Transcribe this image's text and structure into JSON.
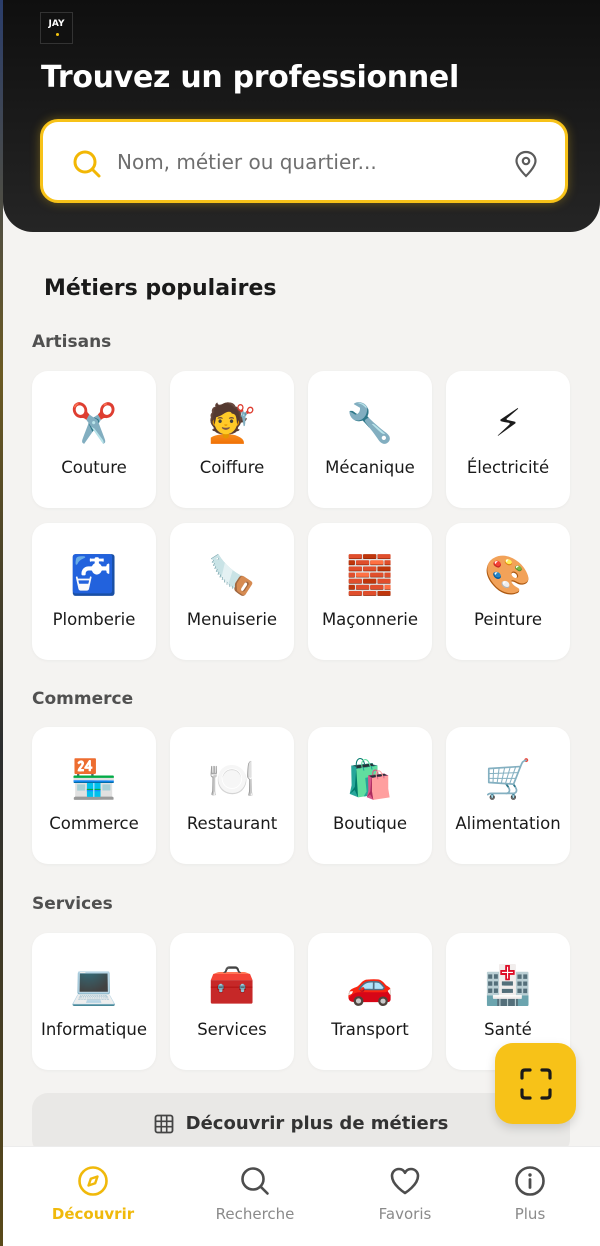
{
  "brand": {
    "logo_text": "JAY"
  },
  "header": {
    "title": "Trouvez un professionnel"
  },
  "search": {
    "placeholder": "Nom, métier ou quartier..."
  },
  "section_title": "Métiers populaires",
  "categories": [
    {
      "label": "Artisans",
      "items": [
        {
          "icon": "scissors-icon",
          "emoji": "✂️",
          "label": "Couture"
        },
        {
          "icon": "hairdresser-icon",
          "emoji": "💇",
          "label": "Coiffure"
        },
        {
          "icon": "wrench-icon",
          "emoji": "🔧",
          "label": "Mécanique"
        },
        {
          "icon": "lightning-icon",
          "emoji": "⚡",
          "label": "Électricité"
        },
        {
          "icon": "water-tap-icon",
          "emoji": "🚰",
          "label": "Plomberie"
        },
        {
          "icon": "saw-icon",
          "emoji": "🪚",
          "label": "Menuiserie"
        },
        {
          "icon": "bricks-icon",
          "emoji": "🧱",
          "label": "Maçonnerie"
        },
        {
          "icon": "palette-icon",
          "emoji": "🎨",
          "label": "Peinture"
        }
      ]
    },
    {
      "label": "Commerce",
      "items": [
        {
          "icon": "convenience-store-icon",
          "emoji": "🏪",
          "label": "Commerce"
        },
        {
          "icon": "plate-cutlery-icon",
          "emoji": "🍽️",
          "label": "Restaurant"
        },
        {
          "icon": "shopping-bags-icon",
          "emoji": "🛍️",
          "label": "Boutique"
        },
        {
          "icon": "shopping-cart-icon",
          "emoji": "🛒",
          "label": "Alimentation"
        }
      ]
    },
    {
      "label": "Services",
      "items": [
        {
          "icon": "laptop-icon",
          "emoji": "💻",
          "label": "Informatique"
        },
        {
          "icon": "toolbox-icon",
          "emoji": "🧰",
          "label": "Services"
        },
        {
          "icon": "car-icon",
          "emoji": "🚗",
          "label": "Transport"
        },
        {
          "icon": "hospital-icon",
          "emoji": "🏥",
          "label": "Santé"
        }
      ]
    }
  ],
  "more_button": {
    "label": "Découvrir plus de métiers"
  },
  "bottom_nav": [
    {
      "label": "Découvrir",
      "icon": "compass-icon",
      "active": true
    },
    {
      "label": "Recherche",
      "icon": "search-icon",
      "active": false
    },
    {
      "label": "Favoris",
      "icon": "heart-icon",
      "active": false
    },
    {
      "label": "Plus",
      "icon": "info-icon",
      "active": false
    }
  ],
  "colors": {
    "accent": "#f7c218",
    "header_bg": "#1a1a1a",
    "page_bg": "#f4f3f1"
  }
}
